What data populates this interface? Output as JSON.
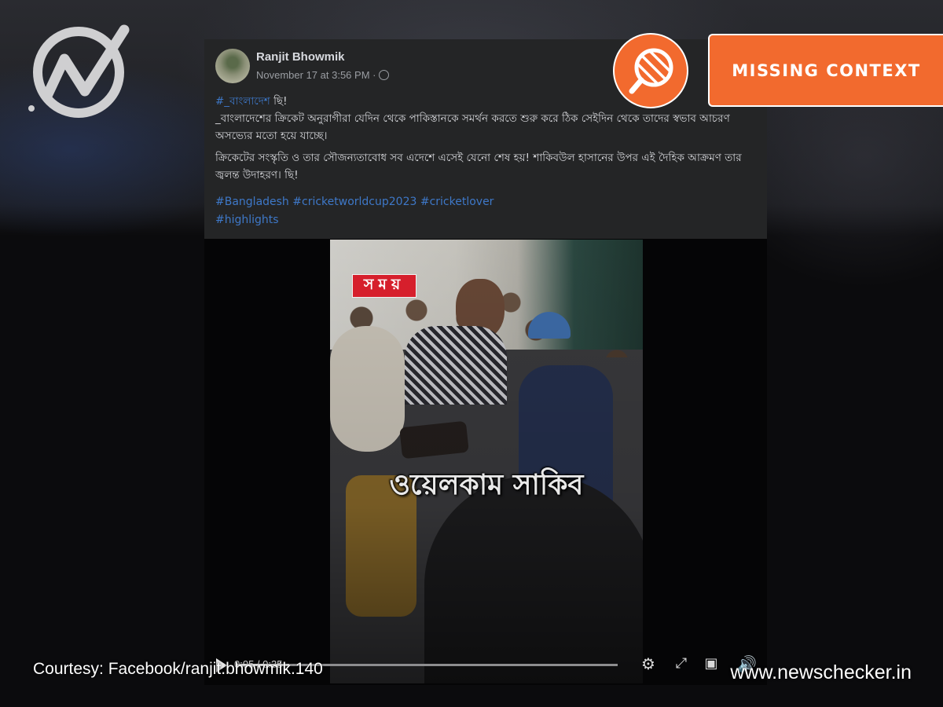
{
  "post": {
    "author": "Ranjit Bhowmik",
    "timestamp": "November 17 at 3:56 PM ·",
    "hashtag_line": "#_বাংলাদেশ",
    "line1_suffix": " ছি!",
    "paragraph1": "_বাংলাদেশের ক্রিকেট অনুরাগীরা যেদিন থেকে পাকিস্তানকে সমর্থন করতে শুরু করে ঠিক সেইদিন থেকে তাদের স্বভাব আচরণ অসভ্যের মতো হয়ে যাচ্ছে।",
    "paragraph2": "ক্রিকেটের সংস্কৃতি ও তার সৌজন্যতাবোধ সব এদেশে এসেই যেনো শেষ হয়! শাকিবউল হাসানের উপর এই দৈহিক আক্রমণ তার জ্বলন্ত উদাহরণ। ছি!",
    "hashtags": [
      "#Bangladesh",
      "#cricketworldcup2023",
      "#cricketlover",
      "#highlights"
    ]
  },
  "badge": {
    "label": "MISSING CONTEXT",
    "color": "#f26a2e",
    "icon": "magnifier-striped-icon"
  },
  "video": {
    "channel_tag": "সময়",
    "caption": "ওয়েলকাম সাকিব",
    "time": "0:05 / 0:35",
    "progress": 0.14
  },
  "footer": {
    "courtesy": "Courtesy: Facebook/ranjit.bhowmik.140",
    "site": "www.newschecker.in"
  }
}
